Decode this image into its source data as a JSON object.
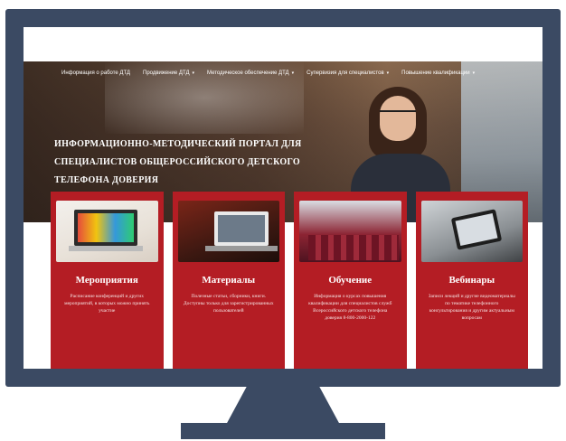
{
  "nav": {
    "items": [
      {
        "label": "Информация о работе ДТД",
        "has_caret": false
      },
      {
        "label": "Продвижение ДТД",
        "has_caret": true
      },
      {
        "label": "Методическое обеспечение ДТД",
        "has_caret": true
      },
      {
        "label": "Супервизия для специалистов",
        "has_caret": true
      },
      {
        "label": "Повышение квалификации",
        "has_caret": true
      }
    ],
    "caret_icon": "chevron-down-icon"
  },
  "hero": {
    "title_line1": "Информационно-методический портал для",
    "title_line2": "специалистов общероссийского детского",
    "title_line3": "телефона доверия"
  },
  "cards": [
    {
      "title": "Мероприятия",
      "text": "Расписание конференций и других мероприятий, в которых можно принять участие",
      "image": "laptop-with-photos-image"
    },
    {
      "title": "Материалы",
      "text": "Полезные статьи, сборники, книги. Доступны только для зарегистрированных пользователей",
      "image": "laptop-on-desk-image"
    },
    {
      "title": "Обучение",
      "text": "Информация о курсах повышения квалификации для специалистов служб Всероссийского детского телефона доверия 8-800-2000-122",
      "image": "conference-hall-image"
    },
    {
      "title": "Вебинары",
      "text": "Записи лекций и другие видеоматериалы по тематике телефонного консультирования и другим актуальным вопросам",
      "image": "tablet-in-hands-image"
    }
  ],
  "colors": {
    "monitor": "#3b4a63",
    "card_red": "#b41d24"
  }
}
